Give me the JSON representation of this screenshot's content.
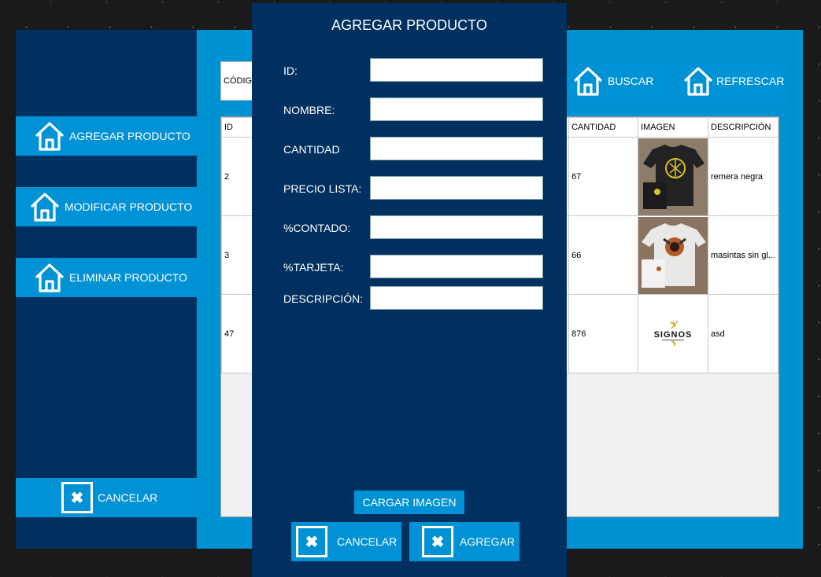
{
  "sidebar": {
    "items": [
      {
        "label": "AGREGAR PRODUCTO",
        "icon": "home-icon"
      },
      {
        "label": "MODIFICAR PRODUCTO",
        "icon": "home-icon"
      },
      {
        "label": "ELIMINAR PRODUCTO",
        "icon": "home-icon"
      }
    ],
    "cancel_label": "CANCELAR"
  },
  "search": {
    "code_label": "CÓDIGO",
    "buscar_label": "BUSCAR",
    "refrescar_label": "REFRESCAR"
  },
  "table": {
    "columns": [
      "ID",
      "CANTIDAD",
      "IMAGEN",
      "DESCRIPCIÓN"
    ],
    "rows": [
      {
        "id": "2",
        "cantidad": "67",
        "imagen": "black-tshirt-image",
        "descripcion": "remera negra"
      },
      {
        "id": "3",
        "cantidad": "66",
        "imagen": "white-tshirt-image",
        "descripcion": "masintas sin gl..."
      },
      {
        "id": "47",
        "cantidad": "876",
        "imagen": "signos-logo-image",
        "descripcion": "asd",
        "logo_text": "SIGNOS"
      }
    ]
  },
  "dialog": {
    "title": "AGREGAR PRODUCTO",
    "fields": [
      {
        "label": "ID:",
        "value": ""
      },
      {
        "label": "NOMBRE:",
        "value": ""
      },
      {
        "label": "CANTIDAD",
        "value": ""
      },
      {
        "label": "PRECIO LISTA:",
        "value": ""
      },
      {
        "label": "%CONTADO:",
        "value": ""
      },
      {
        "label": "%TARJETA:",
        "value": ""
      },
      {
        "label": "DESCRIPCIÓN:",
        "value": ""
      }
    ],
    "load_image_label": "CARGAR IMAGEN",
    "cancel_label": "CANCELAR",
    "add_label": "AGREGAR"
  },
  "colors": {
    "dark_navy": "#00305f",
    "accent_blue": "#0092d4",
    "window_blue": "#0091d2"
  }
}
